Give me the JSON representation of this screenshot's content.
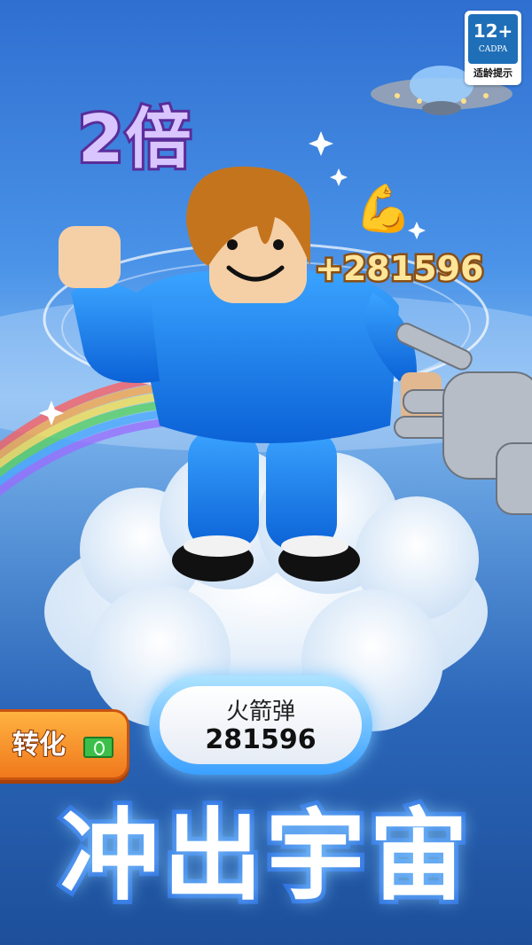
{
  "rating": {
    "age": "12+",
    "org": "CADPA",
    "tip": "适龄提示"
  },
  "multiplier": "2倍",
  "gain": "+281596",
  "counter": {
    "label": "火箭弹",
    "value": "281596"
  },
  "convert_button": {
    "label": "转化",
    "icon": "cash-icon"
  },
  "title": "冲出宇宙",
  "colors": {
    "sky": "#4a93e8",
    "accent": "#2a6ee0",
    "button": "#f0781c",
    "multiplier": "#5a2d9a",
    "gain": "#8a4e12"
  }
}
